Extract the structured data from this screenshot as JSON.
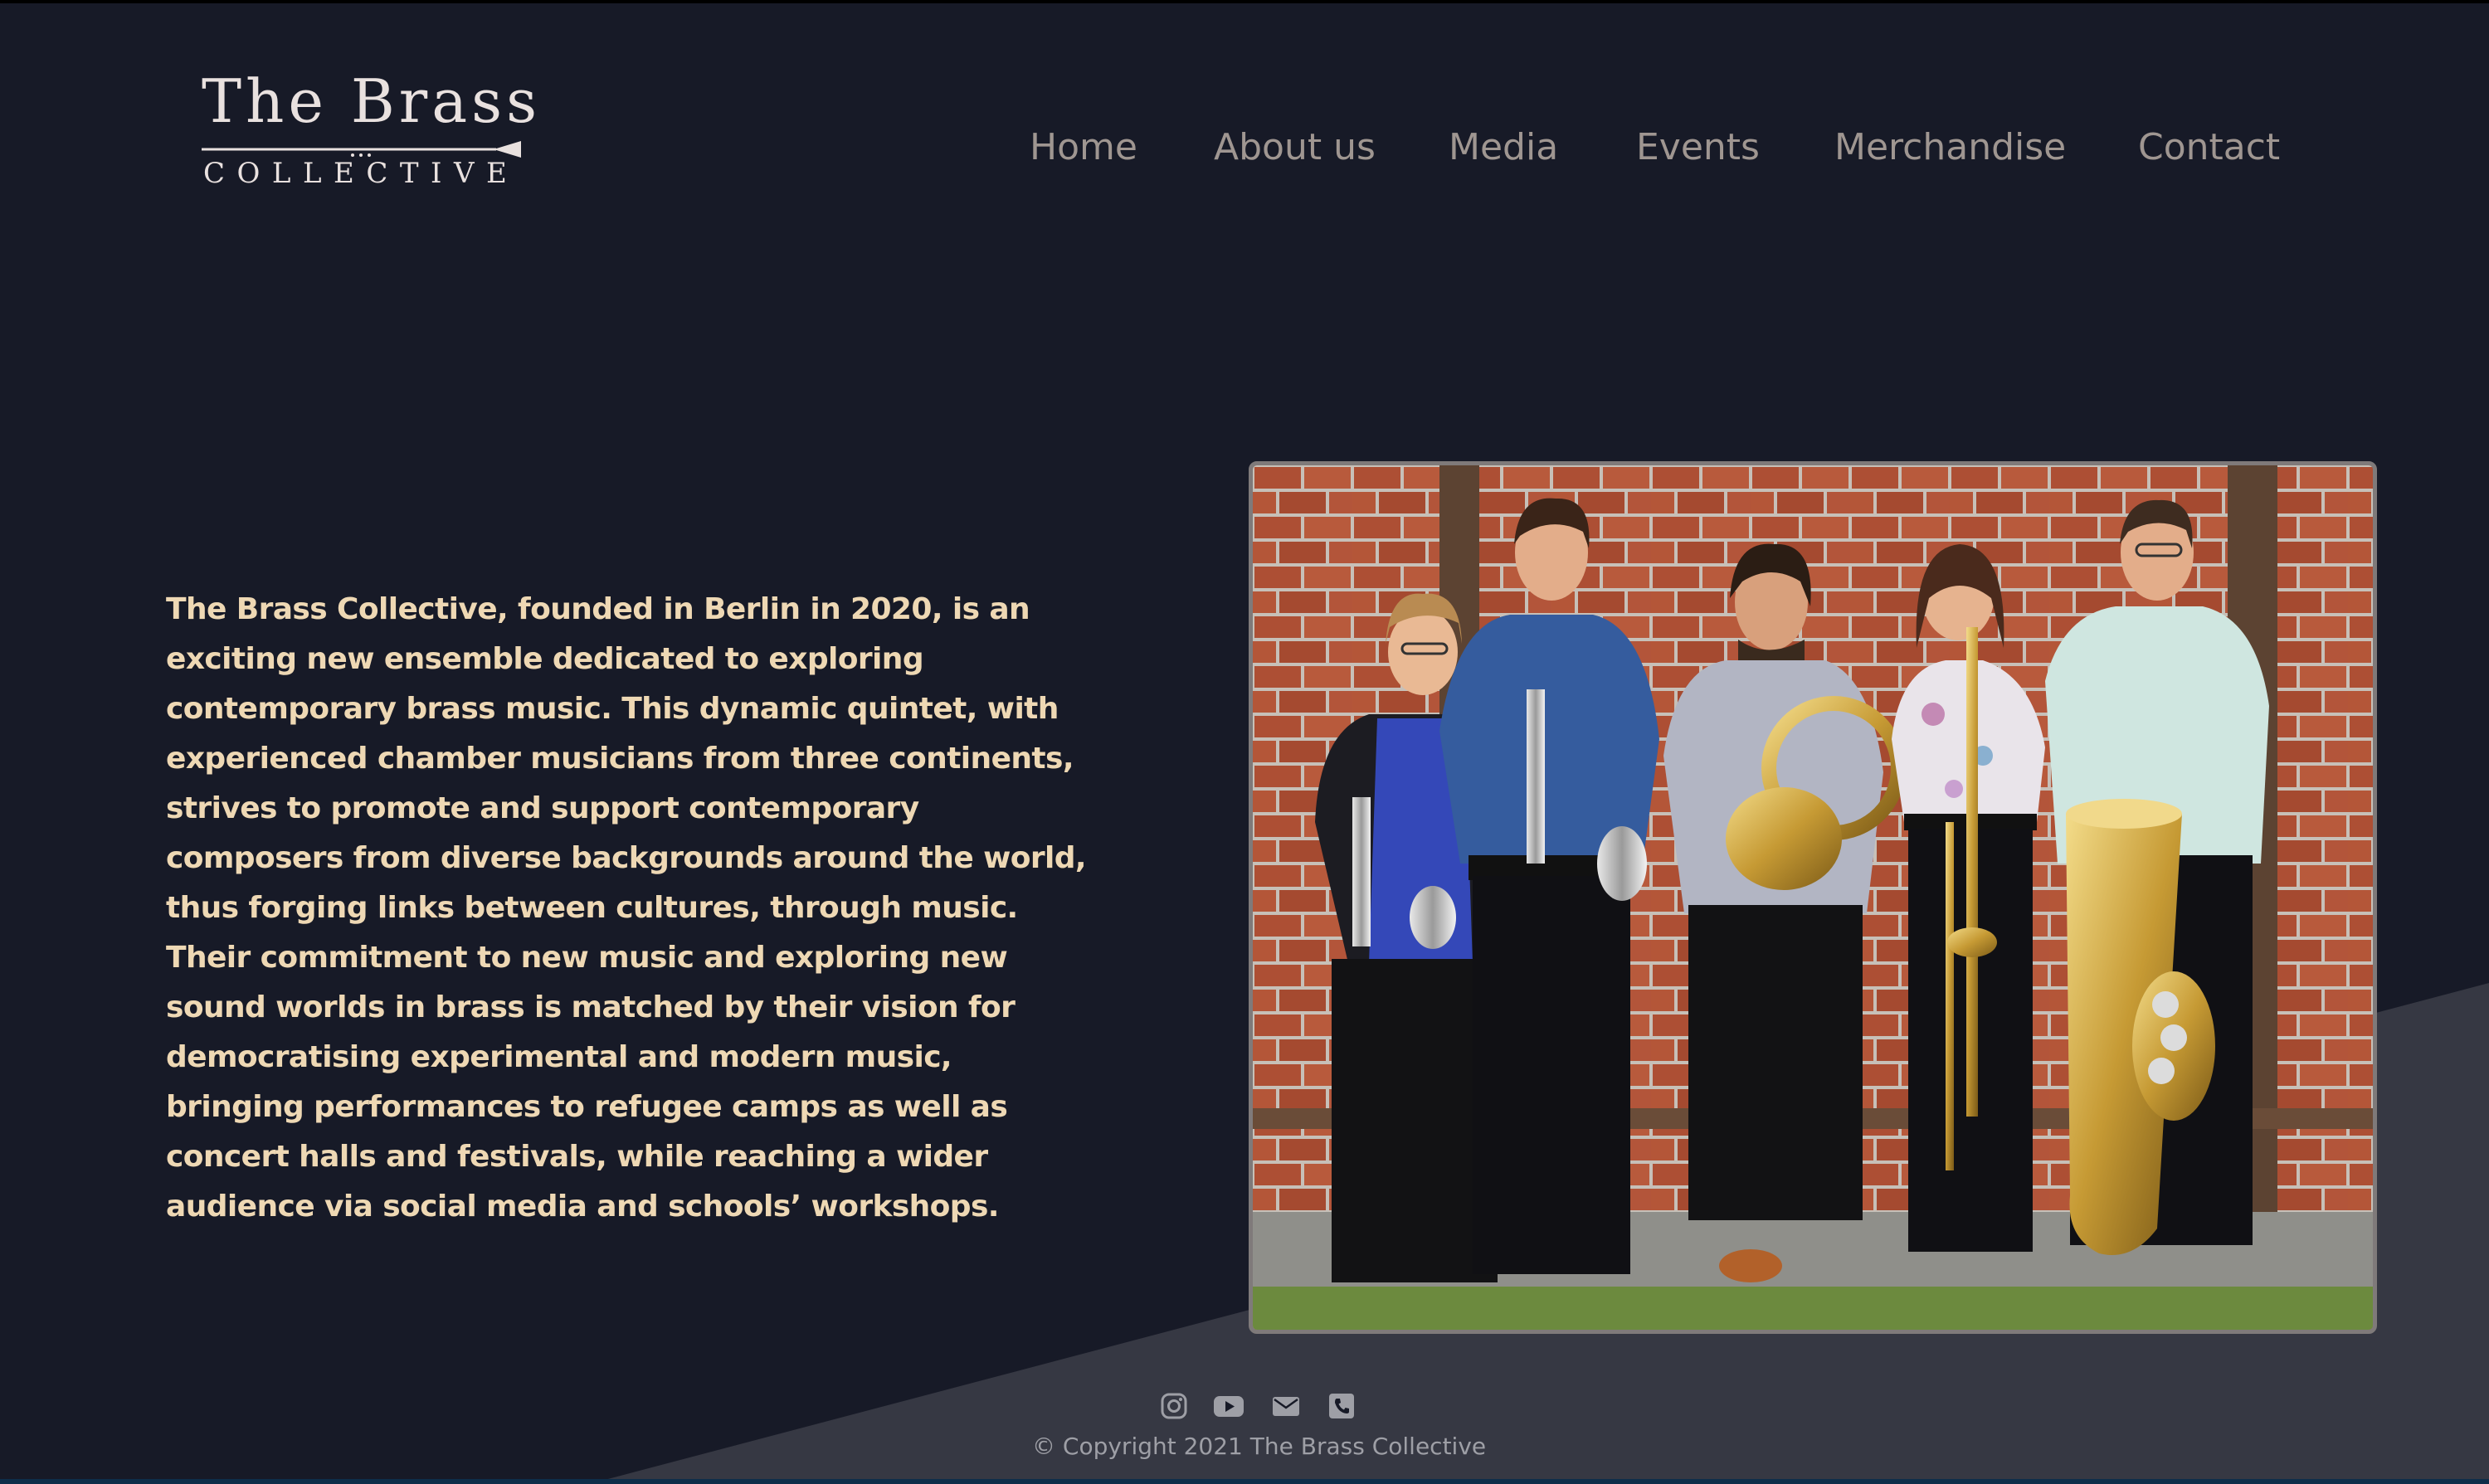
{
  "logo": {
    "title": "The Brass",
    "subtitle": "COLLECTIVE"
  },
  "nav": {
    "items": [
      {
        "label": "Home"
      },
      {
        "label": "About us"
      },
      {
        "label": "Media"
      },
      {
        "label": "Events"
      },
      {
        "label": "Merchandise"
      },
      {
        "label": "Contact"
      }
    ]
  },
  "main": {
    "intro": "The Brass Collective, founded in Berlin in 2020, is an exciting new ensemble dedicated to exploring contemporary brass music. This dynamic quintet, with experienced chamber musicians from three continents, strives to promote and support contemporary composers from diverse backgrounds around the world, thus forging links between cultures, through music. Their commitment to new music and exploring new sound worlds in brass is matched by their vision for democratising experimental and modern music, bringing performances to refugee camps as well as concert halls and festivals, while reaching a wider audience via social media and schools’ workshops."
  },
  "footer": {
    "icons": [
      "instagram-icon",
      "youtube-icon",
      "email-icon",
      "phone-icon"
    ],
    "copyright": "© Copyright 2021 The Brass Collective"
  },
  "colors": {
    "background": "#171a27",
    "diagonal_band": "#363843",
    "nav_text": "#9f9691",
    "intro_text": "#eed8b4",
    "logo_text": "#e9e1df",
    "footer_text": "#9e9fa6"
  }
}
